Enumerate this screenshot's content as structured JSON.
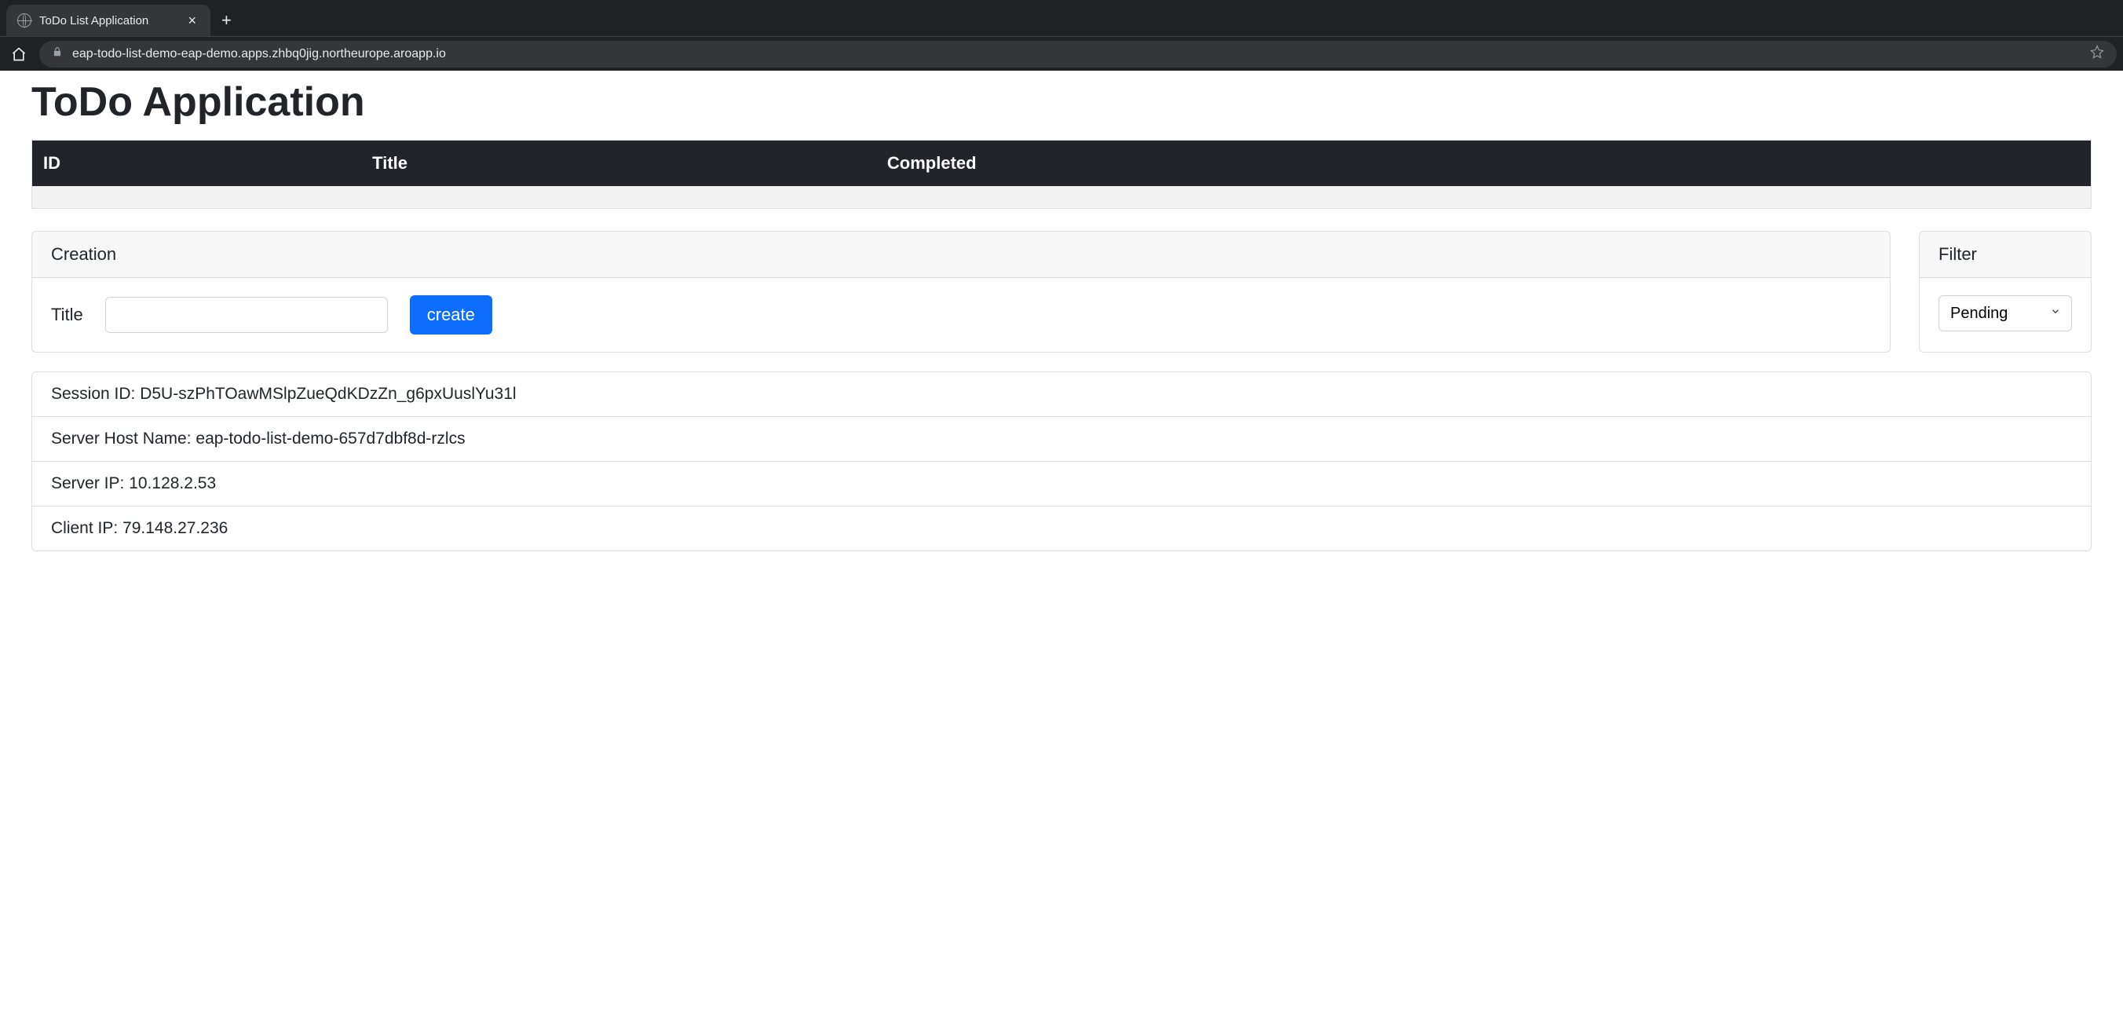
{
  "browser": {
    "tab_title": "ToDo List Application",
    "url": "eap-todo-list-demo-eap-demo.apps.zhbq0jig.northeurope.aroapp.io"
  },
  "page": {
    "title": "ToDo Application"
  },
  "table": {
    "headers": {
      "id": "ID",
      "title": "Title",
      "completed": "Completed"
    }
  },
  "creation": {
    "header": "Creation",
    "title_label": "Title",
    "title_value": "",
    "create_button": "create"
  },
  "filter": {
    "header": "Filter",
    "selected": "Pending"
  },
  "info": {
    "session_id": "Session ID: D5U-szPhTOawMSlpZueQdKDzZn_g6pxUuslYu31l",
    "server_host": "Server Host Name: eap-todo-list-demo-657d7dbf8d-rzlcs",
    "server_ip": "Server IP: 10.128.2.53",
    "client_ip": "Client IP: 79.148.27.236"
  }
}
